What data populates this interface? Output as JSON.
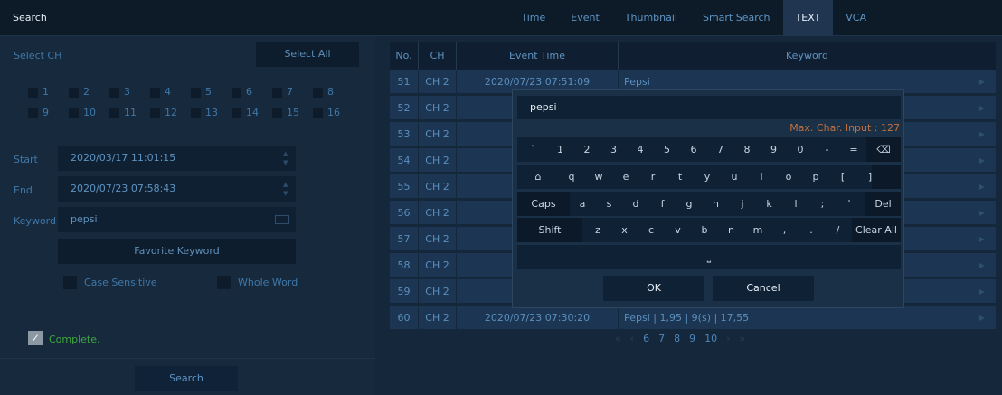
{
  "header": {
    "title": "Search",
    "tabs": [
      "Time",
      "Event",
      "Thumbnail",
      "Smart Search",
      "TEXT",
      "VCA"
    ],
    "active_tab": "TEXT"
  },
  "left_panel": {
    "select_ch_label": "Select CH",
    "select_all_label": "Select All",
    "channels": [
      "1",
      "2",
      "3",
      "4",
      "5",
      "6",
      "7",
      "8",
      "9",
      "10",
      "11",
      "12",
      "13",
      "14",
      "15",
      "16"
    ],
    "start_label": "Start",
    "start_value": "2020/03/17  11:01:15",
    "end_label": "End",
    "end_value": "2020/07/23  07:58:43",
    "keyword_label": "Keyword",
    "keyword_value": "pepsi",
    "favorite_keyword_label": "Favorite Keyword",
    "case_sensitive_label": "Case Sensitive",
    "whole_word_label": "Whole Word",
    "complete_label": "Complete.",
    "search_button_label": "Search"
  },
  "table": {
    "columns": [
      "No.",
      "CH",
      "Event Time",
      "Keyword"
    ],
    "rows": [
      {
        "no": "51",
        "ch": "CH 2",
        "time": "2020/07/23  07:51:09",
        "keyword": "Pepsi"
      },
      {
        "no": "52",
        "ch": "CH 2",
        "time": "2020",
        "keyword": ""
      },
      {
        "no": "53",
        "ch": "CH 2",
        "time": "2020",
        "keyword": ""
      },
      {
        "no": "54",
        "ch": "CH 2",
        "time": "2020",
        "keyword": ""
      },
      {
        "no": "55",
        "ch": "CH 2",
        "time": "2020",
        "keyword": ""
      },
      {
        "no": "56",
        "ch": "CH 2",
        "time": "2020",
        "keyword": ""
      },
      {
        "no": "57",
        "ch": "CH 2",
        "time": "2020",
        "keyword": ""
      },
      {
        "no": "58",
        "ch": "CH 2",
        "time": "2020",
        "keyword": ""
      },
      {
        "no": "59",
        "ch": "CH 2",
        "time": "2020",
        "keyword": ""
      },
      {
        "no": "60",
        "ch": "CH 2",
        "time": "2020/07/23  07:30:20",
        "keyword": "Pepsi      |    1,95 |      9(s) |         17,55"
      }
    ],
    "pagination": {
      "prev_first": "«",
      "prev": "‹",
      "pages": [
        "6",
        "7",
        "8",
        "9",
        "10"
      ],
      "next": "›",
      "next_last": "»"
    }
  },
  "keyboard": {
    "input_value": "pepsi",
    "max_char_label": "Max. Char. Input : 127",
    "row1": [
      "`",
      "1",
      "2",
      "3",
      "4",
      "5",
      "6",
      "7",
      "8",
      "9",
      "0",
      "-",
      "="
    ],
    "row2": [
      "q",
      "w",
      "e",
      "r",
      "t",
      "y",
      "u",
      "i",
      "o",
      "p",
      "[",
      "]"
    ],
    "row3": [
      "a",
      "s",
      "d",
      "f",
      "g",
      "h",
      "j",
      "k",
      "l",
      ";",
      "'"
    ],
    "row4": [
      "z",
      "x",
      "c",
      "v",
      "b",
      "n",
      "m",
      ",",
      ".",
      "/"
    ],
    "caps_label": "Caps",
    "del_label": "Del",
    "shift_label": "Shift",
    "clear_all_label": "Clear All",
    "ok_label": "OK",
    "cancel_label": "Cancel"
  }
}
